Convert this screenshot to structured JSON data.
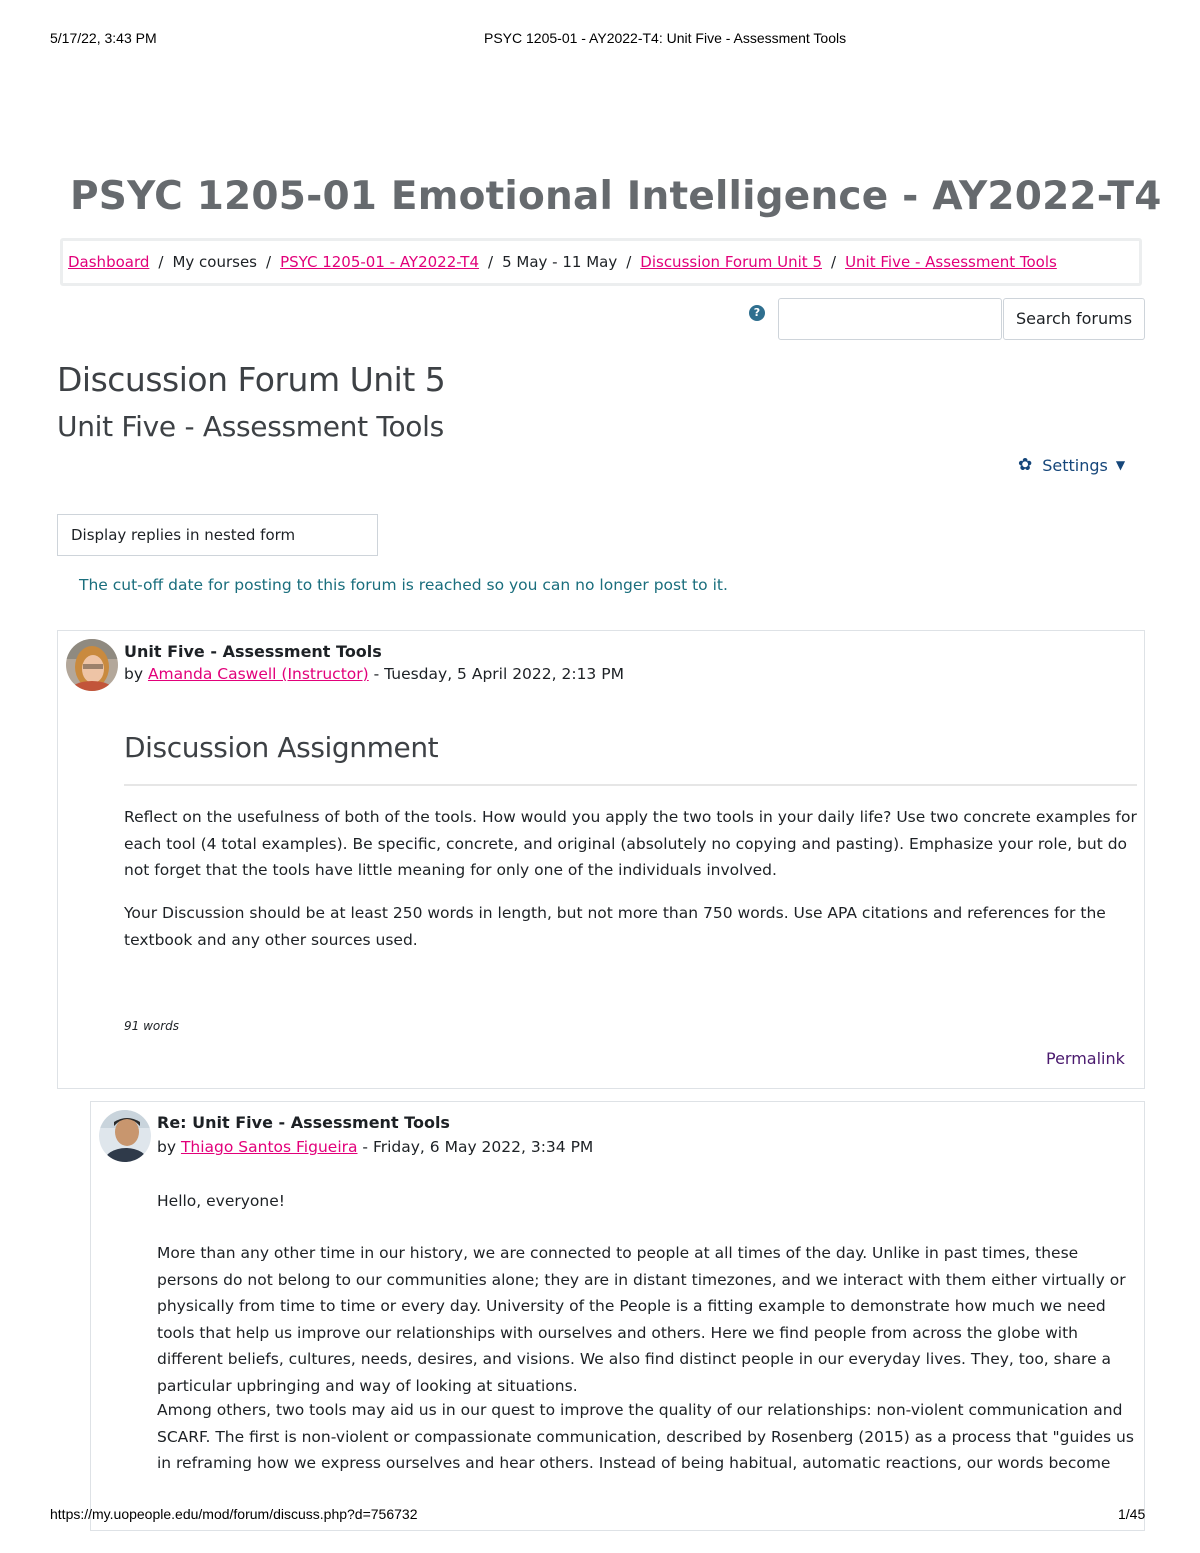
{
  "print_header": {
    "datetime": "5/17/22, 3:43 PM",
    "page_title": "PSYC 1205-01 - AY2022-T4: Unit Five - Assessment Tools"
  },
  "course_title": "PSYC 1205-01 Emotional Intelligence - AY2022-T4",
  "breadcrumb": [
    {
      "label": "Dashboard",
      "link": true
    },
    {
      "label": "My courses",
      "link": false
    },
    {
      "label": "PSYC 1205-01 - AY2022-T4",
      "link": true
    },
    {
      "label": "5 May - 11 May",
      "link": false
    },
    {
      "label": "Discussion Forum Unit 5",
      "link": true
    },
    {
      "label": "Unit Five - Assessment Tools",
      "link": true
    }
  ],
  "search": {
    "button_label": "Search forums",
    "value": "",
    "help_icon": "?"
  },
  "forum_title": "Discussion Forum Unit 5",
  "discussion_title": "Unit Five - Assessment Tools",
  "settings_label": "Settings",
  "display_mode": "Display replies in nested form",
  "cutoff_notice": "The cut-off date for posting to this forum is reached so you can no longer post to it.",
  "posts": [
    {
      "subject": "Unit Five - Assessment Tools",
      "by": "by",
      "author": "Amanda Caswell (Instructor)",
      "date": " - Tuesday, 5 April 2022, 2:13 PM",
      "heading": "Discussion Assignment",
      "paragraphs": [
        "Reflect on the usefulness of both of the tools. How would you apply the two tools in your daily life? Use two concrete examples for each tool (4 total examples). Be specific, concrete, and original (absolutely no copying and pasting). Emphasize your role, but do not forget that the tools have little meaning for only one of the individuals involved.",
        "Your Discussion should be at least 250 words in length, but not more than 750 words. Use APA citations and references for the textbook and any other sources used."
      ],
      "word_count": "91 words",
      "permalink": "Permalink"
    },
    {
      "subject": "Re: Unit Five - Assessment Tools",
      "by": "by",
      "author": "Thiago Santos Figueira",
      "date": " - Friday, 6 May 2022, 3:34 PM",
      "paragraphs": [
        "Hello, everyone!",
        "More than any other time in our history, we are connected to people at all times of the day. Unlike in past times, these persons do not belong to our communities alone; they are in distant timezones, and we interact with them either virtually or physically from time to time or every day. University of the People is a fitting example to demonstrate how much we need tools that help us improve our relationships with ourselves and others. Here we find people from across the globe with different beliefs, cultures, needs, desires, and visions. We also find distinct people in our everyday lives. They, too, share a particular upbringing and way of looking at situations.",
        "Among others, two tools may aid us in our quest to improve the quality of our relationships: non-violent communication and SCARF. The first is non-violent or compassionate communication, described by Rosenberg (2015) as a process that \"guides us in reframing how we express ourselves and hear others. Instead of being habitual, automatic reactions, our words become"
      ]
    }
  ],
  "print_footer": {
    "url": "https://my.uopeople.edu/mod/forum/discuss.php?d=756732",
    "page": "1/45"
  }
}
